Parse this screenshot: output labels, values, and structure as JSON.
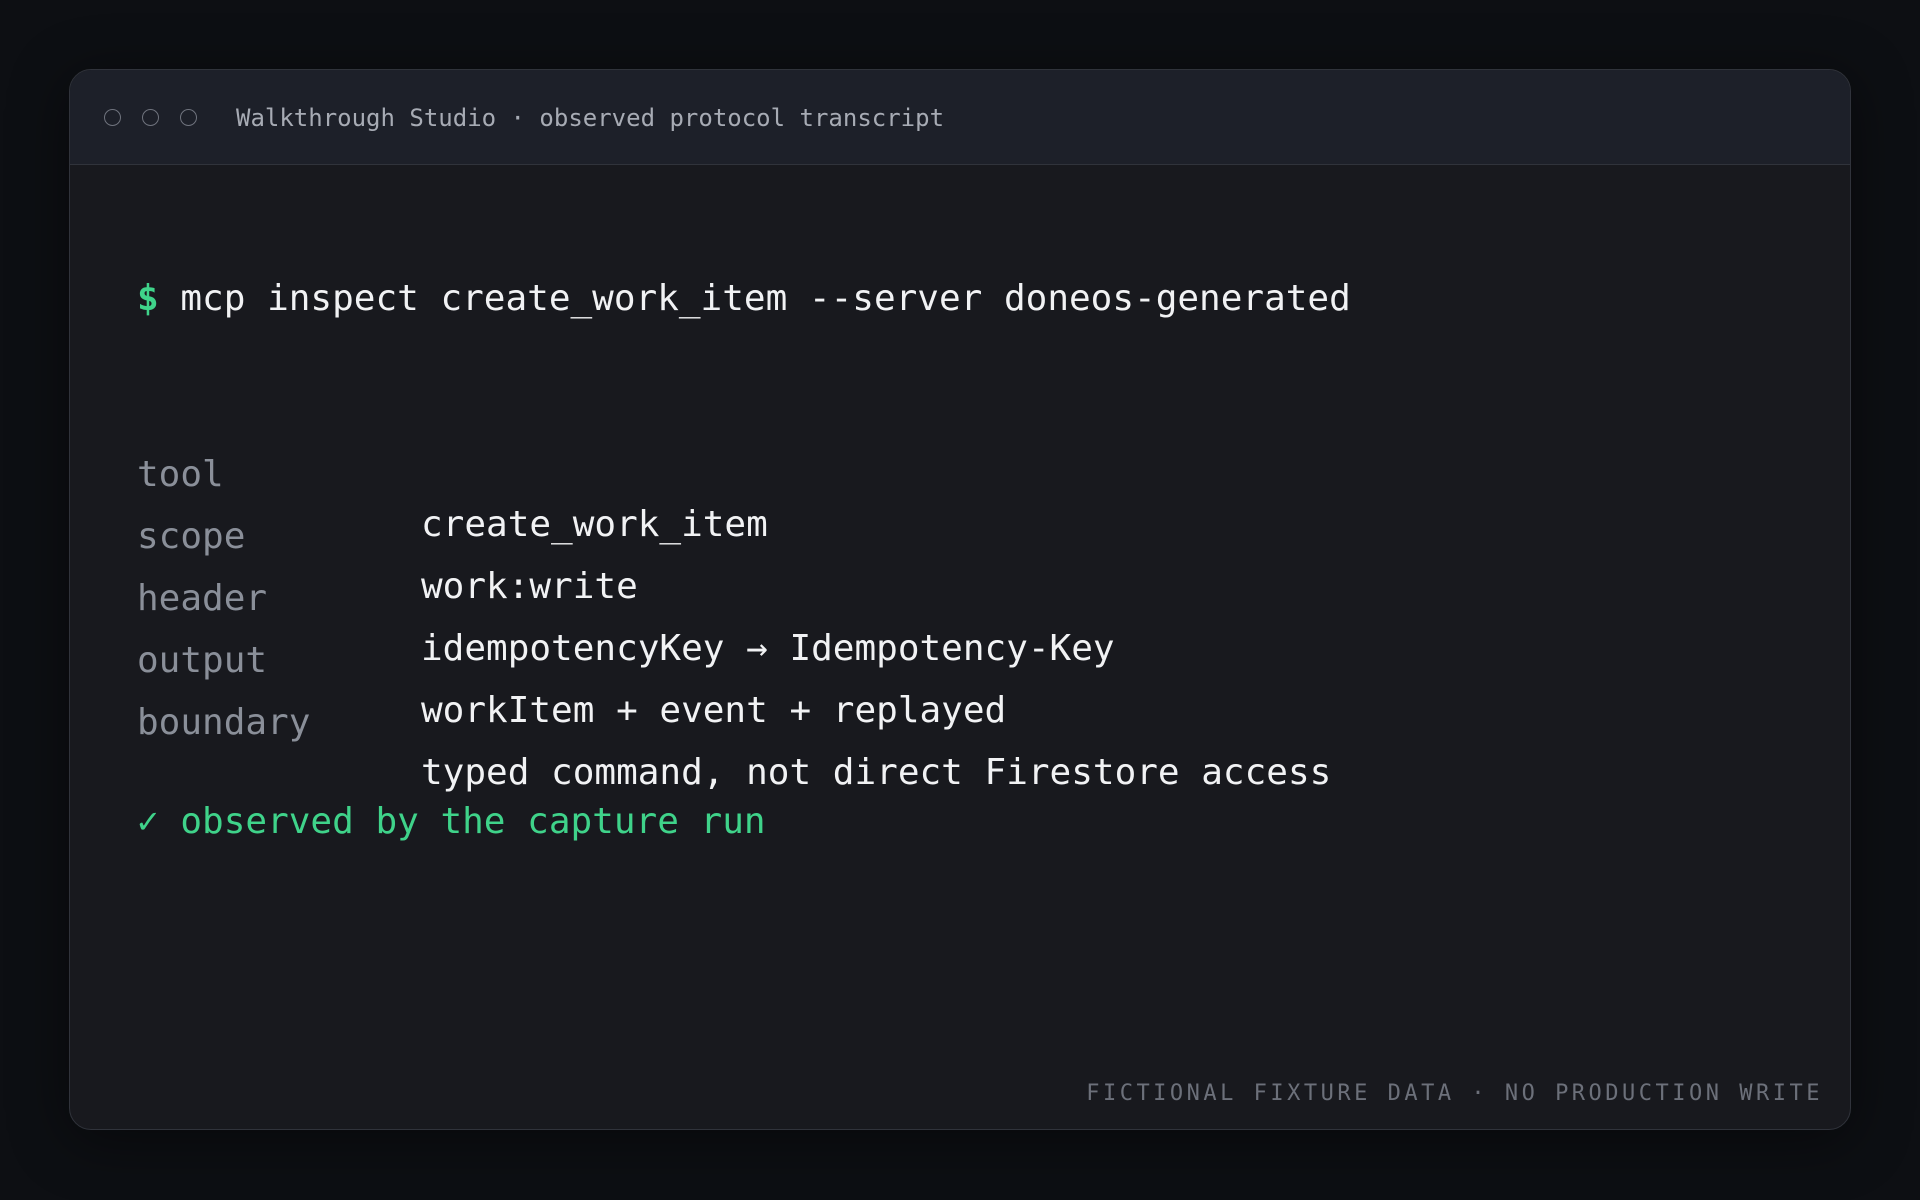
{
  "window": {
    "title": "Walkthrough Studio · observed protocol transcript"
  },
  "terminal": {
    "prompt": "$",
    "command": "mcp inspect create_work_item --server doneos-generated",
    "rows": [
      {
        "key": "tool",
        "value": "create_work_item"
      },
      {
        "key": "scope",
        "value": "work:write"
      },
      {
        "key": "header",
        "value": "idempotencyKey → Idempotency-Key"
      },
      {
        "key": "output",
        "value": "workItem + event + replayed"
      },
      {
        "key": "boundary",
        "value": "typed command, not direct Firestore access"
      }
    ],
    "status_icon": "✓",
    "status_text": "observed by the capture run"
  },
  "footer": {
    "notice": "FICTIONAL FIXTURE DATA · NO PRODUCTION WRITE"
  },
  "colors": {
    "accent_green": "#3fd38a",
    "background": "#18191e",
    "titlebar": "#1d2029"
  }
}
